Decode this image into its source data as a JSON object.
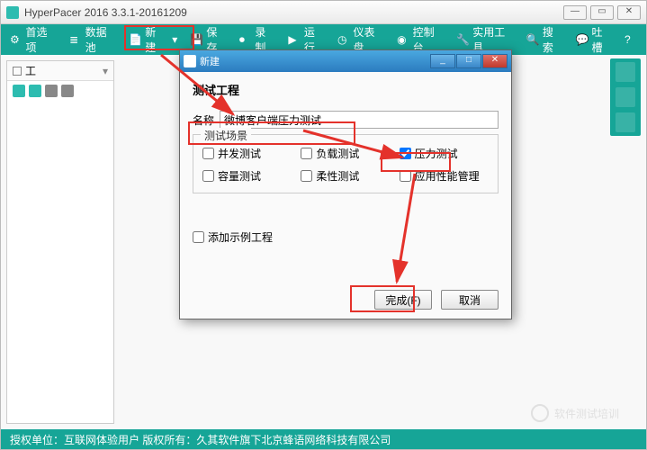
{
  "app": {
    "title": "HyperPacer  2016 3.3.1-20161209"
  },
  "toolbar": {
    "items": [
      {
        "label": "首选项"
      },
      {
        "label": "数据池"
      },
      {
        "label": "新建"
      },
      {
        "label": "保存"
      },
      {
        "label": "录制"
      },
      {
        "label": "运行"
      },
      {
        "label": "仪表盘"
      },
      {
        "label": "控制台"
      },
      {
        "label": "实用工具"
      },
      {
        "label": "搜索"
      },
      {
        "label": "吐槽"
      }
    ]
  },
  "panel": {
    "title": "工"
  },
  "dialog": {
    "title": "新建",
    "heading": "测试工程",
    "name_label": "名称",
    "name_value": "微博客户端压力测试",
    "scene_legend": "测试场景",
    "checks": {
      "concurrent": "并发测试",
      "load": "负载测试",
      "pressure": "压力测试",
      "capacity": "容量测试",
      "flex": "柔性测试",
      "apm": "应用性能管理"
    },
    "add_example": "添加示例工程",
    "finish": "完成(F)",
    "cancel": "取消"
  },
  "status": "授权单位：互联网体验用户  版权所有：久其软件旗下北京蜂语网络科技有限公司",
  "watermark": "软件测试培训"
}
